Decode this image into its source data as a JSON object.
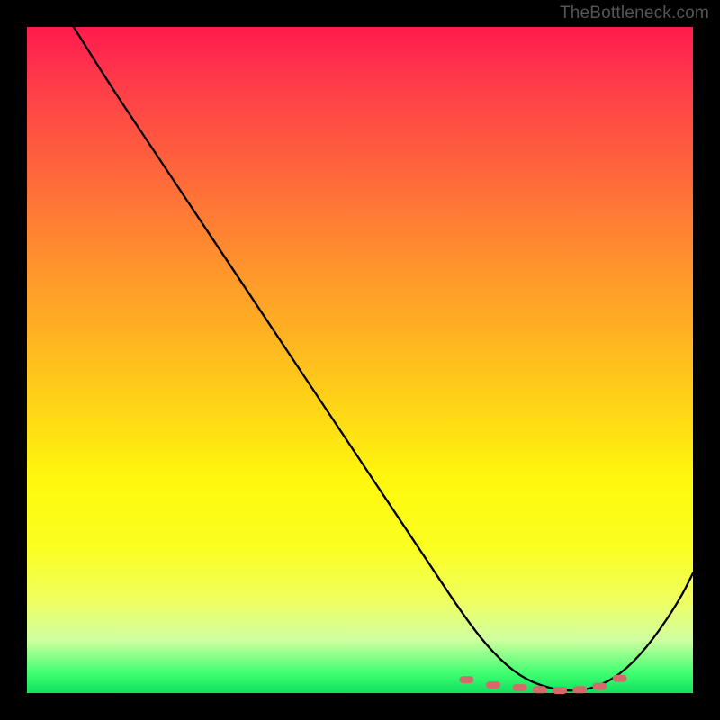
{
  "watermark": "TheBottleneck.com",
  "chart_data": {
    "type": "line",
    "title": "",
    "xlabel": "",
    "ylabel": "",
    "xlim": [
      0,
      100
    ],
    "ylim": [
      0,
      100
    ],
    "series": [
      {
        "name": "curve",
        "x": [
          7,
          12,
          18,
          24,
          30,
          36,
          42,
          48,
          54,
          60,
          66,
          70,
          74,
          78,
          82,
          86,
          90,
          94,
          98,
          100
        ],
        "values": [
          100,
          92,
          83,
          74,
          65,
          56,
          47,
          38,
          29,
          20,
          11,
          6,
          2.5,
          0.8,
          0.2,
          1.0,
          3.5,
          8,
          14,
          18
        ]
      }
    ],
    "markers": {
      "name": "bottleneck-range",
      "x": [
        66,
        70,
        74,
        77,
        80,
        83,
        86,
        89
      ],
      "values": [
        2.0,
        1.2,
        0.8,
        0.5,
        0.4,
        0.5,
        1.0,
        2.2
      ]
    },
    "background": "rainbow-gradient (red top → green bottom)"
  }
}
